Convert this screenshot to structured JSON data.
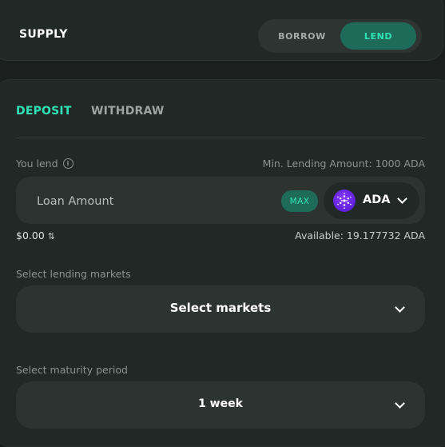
{
  "header": {
    "title": "SUPPLY",
    "toggle": {
      "borrow_label": "BORROW",
      "lend_label": "LEND",
      "active": "LEND"
    }
  },
  "tabs": {
    "deposit_label": "DEPOSIT",
    "withdraw_label": "WITHDRAW",
    "active": "DEPOSIT"
  },
  "lend": {
    "label": "You lend",
    "info_icon": "info-icon",
    "min_amount": "Min. Lending Amount: 1000 ADA",
    "amount_placeholder": "Loan Amount",
    "amount_value": "",
    "max_label": "MAX",
    "asset": "ADA",
    "usd_value": "$0.00",
    "swap_icon": "⇅",
    "available": "Available: 19.177732 ADA"
  },
  "markets": {
    "label": "Select lending markets",
    "value": "Select markets"
  },
  "maturity": {
    "label": "Select maturity period",
    "value": "1 week"
  },
  "colors": {
    "accent": "#2fe3b6",
    "accent_bg": "#1f6b5a",
    "background": "#1b201e",
    "panel": "#222826",
    "field": "#2c3331",
    "ada": "#6a1fff"
  }
}
